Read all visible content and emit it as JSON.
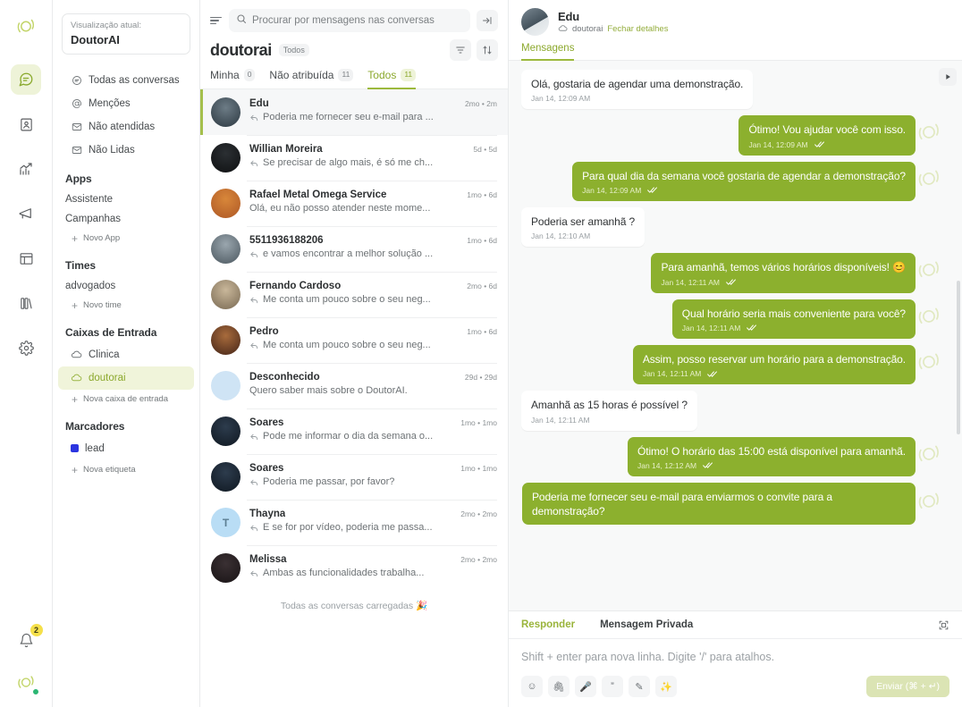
{
  "rail": {
    "logo_name": "app-logo",
    "items": [
      {
        "name": "conversations",
        "icon": "chat-bubble-icon",
        "active": true
      },
      {
        "name": "contacts",
        "icon": "contact-card-icon",
        "active": false
      },
      {
        "name": "reports",
        "icon": "chart-arrow-icon",
        "active": false
      },
      {
        "name": "campaigns",
        "icon": "megaphone-icon",
        "active": false
      },
      {
        "name": "portal",
        "icon": "portal-icon",
        "active": false
      },
      {
        "name": "help-center",
        "icon": "books-icon",
        "active": false
      },
      {
        "name": "settings",
        "icon": "gear-icon",
        "active": false
      }
    ],
    "notifications_badge": "2"
  },
  "sidebar": {
    "current_view_label": "Visualização atual:",
    "current_view_value": "DoutorAI",
    "nav": [
      {
        "label": "Todas as conversas",
        "icon": "inbox-circle-icon"
      },
      {
        "label": "Menções",
        "icon": "at-icon"
      },
      {
        "label": "Não atendidas",
        "icon": "envelope-icon"
      },
      {
        "label": "Não Lidas",
        "icon": "envelope-icon"
      }
    ],
    "apps_title": "Apps",
    "apps": [
      {
        "label": "Assistente"
      },
      {
        "label": "Campanhas"
      }
    ],
    "apps_add": "Novo App",
    "teams_title": "Times",
    "teams": [
      {
        "label": "advogados"
      }
    ],
    "teams_add": "Novo time",
    "inboxes_title": "Caixas de Entrada",
    "inboxes": [
      {
        "label": "Clinica",
        "icon": "cloud-icon",
        "selected": false
      },
      {
        "label": "doutorai",
        "icon": "cloud-icon",
        "selected": true
      }
    ],
    "inboxes_add": "Nova caixa de entrada",
    "labels_title": "Marcadores",
    "labels": [
      {
        "label": "lead",
        "color": "#2c35e0"
      }
    ],
    "labels_add": "Nova etiqueta"
  },
  "list": {
    "search_placeholder": "Procurar por mensagens nas conversas",
    "search_value": "",
    "title": "doutorai",
    "title_chip": "Todos",
    "tabs": [
      {
        "label": "Minha",
        "count": "0",
        "active": false
      },
      {
        "label": "Não atribuída",
        "count": "11",
        "active": false
      },
      {
        "label": "Todos",
        "count": "11",
        "active": true
      }
    ],
    "end_text": "Todas as conversas carregadas 🎉",
    "conversations": [
      {
        "name": "Edu",
        "preview": "Poderia me fornecer seu e-mail para ...",
        "time": "2mo • 2m",
        "replied": true,
        "active": true,
        "avatar_type": "photo",
        "avatar_colors": [
          "#6d7c86",
          "#3a4750"
        ],
        "initial": ""
      },
      {
        "name": "Willian Moreira",
        "preview": "Se precisar de algo mais, é só me ch...",
        "time": "5d • 5d",
        "replied": true,
        "active": false,
        "avatar_type": "photo",
        "avatar_colors": [
          "#2b2f33",
          "#151719"
        ],
        "initial": ""
      },
      {
        "name": "Rafael Metal Omega Service",
        "preview": "Olá, eu não posso atender neste mome...",
        "time": "1mo • 6d",
        "replied": false,
        "active": false,
        "avatar_type": "photo",
        "avatar_colors": [
          "#d8873a",
          "#b7622a"
        ],
        "initial": ""
      },
      {
        "name": "5511936188206",
        "preview": "e vamos encontrar a melhor solução ...",
        "time": "1mo • 6d",
        "replied": true,
        "active": false,
        "avatar_type": "photo",
        "avatar_colors": [
          "#9aa6ae",
          "#5c6870"
        ],
        "initial": ""
      },
      {
        "name": "Fernando Cardoso",
        "preview": "Me conta um pouco sobre o seu neg...",
        "time": "2mo • 6d",
        "replied": true,
        "active": false,
        "avatar_type": "photo",
        "avatar_colors": [
          "#c9b79a",
          "#8a7a62"
        ],
        "initial": ""
      },
      {
        "name": "Pedro",
        "preview": "Me conta um pouco sobre o seu neg...",
        "time": "1mo • 6d",
        "replied": true,
        "active": false,
        "avatar_type": "photo",
        "avatar_colors": [
          "#a86b3c",
          "#5a3420"
        ],
        "initial": ""
      },
      {
        "name": "Desconhecido",
        "preview": "Quero saber mais sobre o DoutorAI.",
        "time": "29d • 29d",
        "replied": false,
        "active": false,
        "avatar_type": "blank",
        "avatar_colors": [
          "#cfe4f5",
          "#cfe4f5"
        ],
        "initial": ""
      },
      {
        "name": "Soares",
        "preview": "Pode me informar o dia da semana o...",
        "time": "1mo • 1mo",
        "replied": true,
        "active": false,
        "avatar_type": "photo",
        "avatar_colors": [
          "#2d3c4d",
          "#16202b"
        ],
        "initial": ""
      },
      {
        "name": "Soares",
        "preview": "Poderia me passar, por favor?",
        "time": "1mo • 1mo",
        "replied": true,
        "active": false,
        "avatar_type": "photo",
        "avatar_colors": [
          "#2d3c4d",
          "#16202b"
        ],
        "initial": ""
      },
      {
        "name": "Thayna",
        "preview": "E se for por vídeo, poderia me passa...",
        "time": "2mo • 2mo",
        "replied": true,
        "active": false,
        "avatar_type": "initial",
        "avatar_colors": [
          "#b9ddf5",
          "#b9ddf5"
        ],
        "initial": "T"
      },
      {
        "name": "Melissa",
        "preview": "Ambas as funcionalidades trabalha...",
        "time": "2mo • 2mo",
        "replied": true,
        "active": false,
        "avatar_type": "photo",
        "avatar_colors": [
          "#3a3033",
          "#201a1c"
        ],
        "initial": ""
      }
    ]
  },
  "chat": {
    "contact_name": "Edu",
    "inbox_label": "doutorai",
    "details_link": "Fechar detalhes",
    "tabs": [
      {
        "label": "Mensagens",
        "active": true
      }
    ],
    "messages": [
      {
        "dir": "in",
        "text": "Olá, gostaria de agendar uma demonstração.",
        "time": "Jan 14, 12:09 AM",
        "tick": false,
        "width": "auto"
      },
      {
        "dir": "out",
        "text": "Ótimo! Vou ajudar você com isso.",
        "time": "Jan 14, 12:09 AM",
        "tick": true
      },
      {
        "dir": "out",
        "text": "Para qual dia da semana você gostaria de agendar a demonstração?",
        "time": "Jan 14, 12:09 AM",
        "tick": true
      },
      {
        "dir": "in",
        "text": "Poderia ser amanhã ?",
        "time": "Jan 14, 12:10 AM",
        "tick": false
      },
      {
        "dir": "out",
        "text": "Para amanhã, temos vários horários disponíveis! 😊",
        "time": "Jan 14, 12:11 AM",
        "tick": true
      },
      {
        "dir": "out",
        "text": "Qual horário seria mais conveniente para você?",
        "time": "Jan 14, 12:11 AM",
        "tick": true
      },
      {
        "dir": "out",
        "text": "Assim, posso reservar um horário para a demonstração.",
        "time": "Jan 14, 12:11 AM",
        "tick": true
      },
      {
        "dir": "in",
        "text": "Amanhã as 15 horas é possível ?",
        "time": "Jan 14, 12:11 AM",
        "tick": false
      },
      {
        "dir": "out",
        "text": "Ótimo! O horário das 15:00 está disponível para amanhã.",
        "time": "Jan 14, 12:12 AM",
        "tick": true
      },
      {
        "dir": "out",
        "text": "Poderia me fornecer seu e-mail para enviarmos o convite para a demonstração?",
        "time": "",
        "tick": false
      }
    ]
  },
  "composer": {
    "tabs": [
      {
        "label": "Responder",
        "active": true
      },
      {
        "label": "Mensagem Privada",
        "active": false
      }
    ],
    "placeholder": "Shift + enter para nova linha. Digite '/' para atalhos.",
    "tools": [
      {
        "name": "emoji-icon",
        "glyph": "☺"
      },
      {
        "name": "attachment-icon",
        "glyph": "🖇"
      },
      {
        "name": "microphone-icon",
        "glyph": "🎤"
      },
      {
        "name": "canned-response-icon",
        "glyph": "”"
      },
      {
        "name": "signature-icon",
        "glyph": "✎"
      },
      {
        "name": "ai-assist-icon",
        "glyph": "✨"
      }
    ],
    "send_label": "Enviar (⌘ + ↵)"
  },
  "colors": {
    "accent": "#8cb02e",
    "accent_soft": "#eef3d8",
    "send_disabled": "#dbe4b4",
    "label_lead": "#2c35e0",
    "badge_bell": "#f5e04a"
  }
}
